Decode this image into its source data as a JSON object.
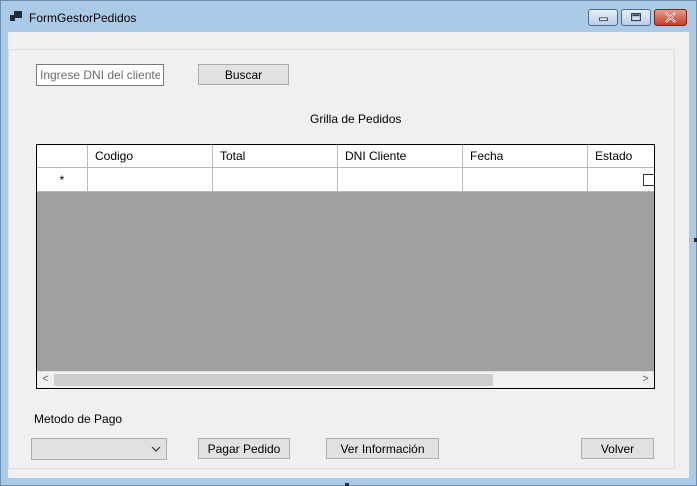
{
  "window": {
    "title": "FormGestorPedidos",
    "controls": {
      "minimize": "minimize",
      "maximize": "maximize",
      "close": "close"
    }
  },
  "search": {
    "placeholder": "Ingrese DNI del cliente",
    "value": "",
    "button_label": "Buscar"
  },
  "grid": {
    "title": "Grilla de Pedidos",
    "columns": [
      "Codigo",
      "Total",
      "DNI Cliente",
      "Fecha",
      "Estado"
    ],
    "new_row_marker": "*",
    "scroll_left": "<",
    "scroll_right": ">"
  },
  "payment": {
    "label": "Metodo de Pago",
    "selected": ""
  },
  "actions": {
    "pay_label": "Pagar Pedido",
    "info_label": "Ver Información",
    "back_label": "Volver"
  },
  "colors": {
    "titlebar": "#aacbe8",
    "client_bg": "#f0f0f0",
    "grid_empty_bg": "#a0a0a0",
    "button_bg": "#e1e1e1",
    "close_button": "#c4402a"
  }
}
